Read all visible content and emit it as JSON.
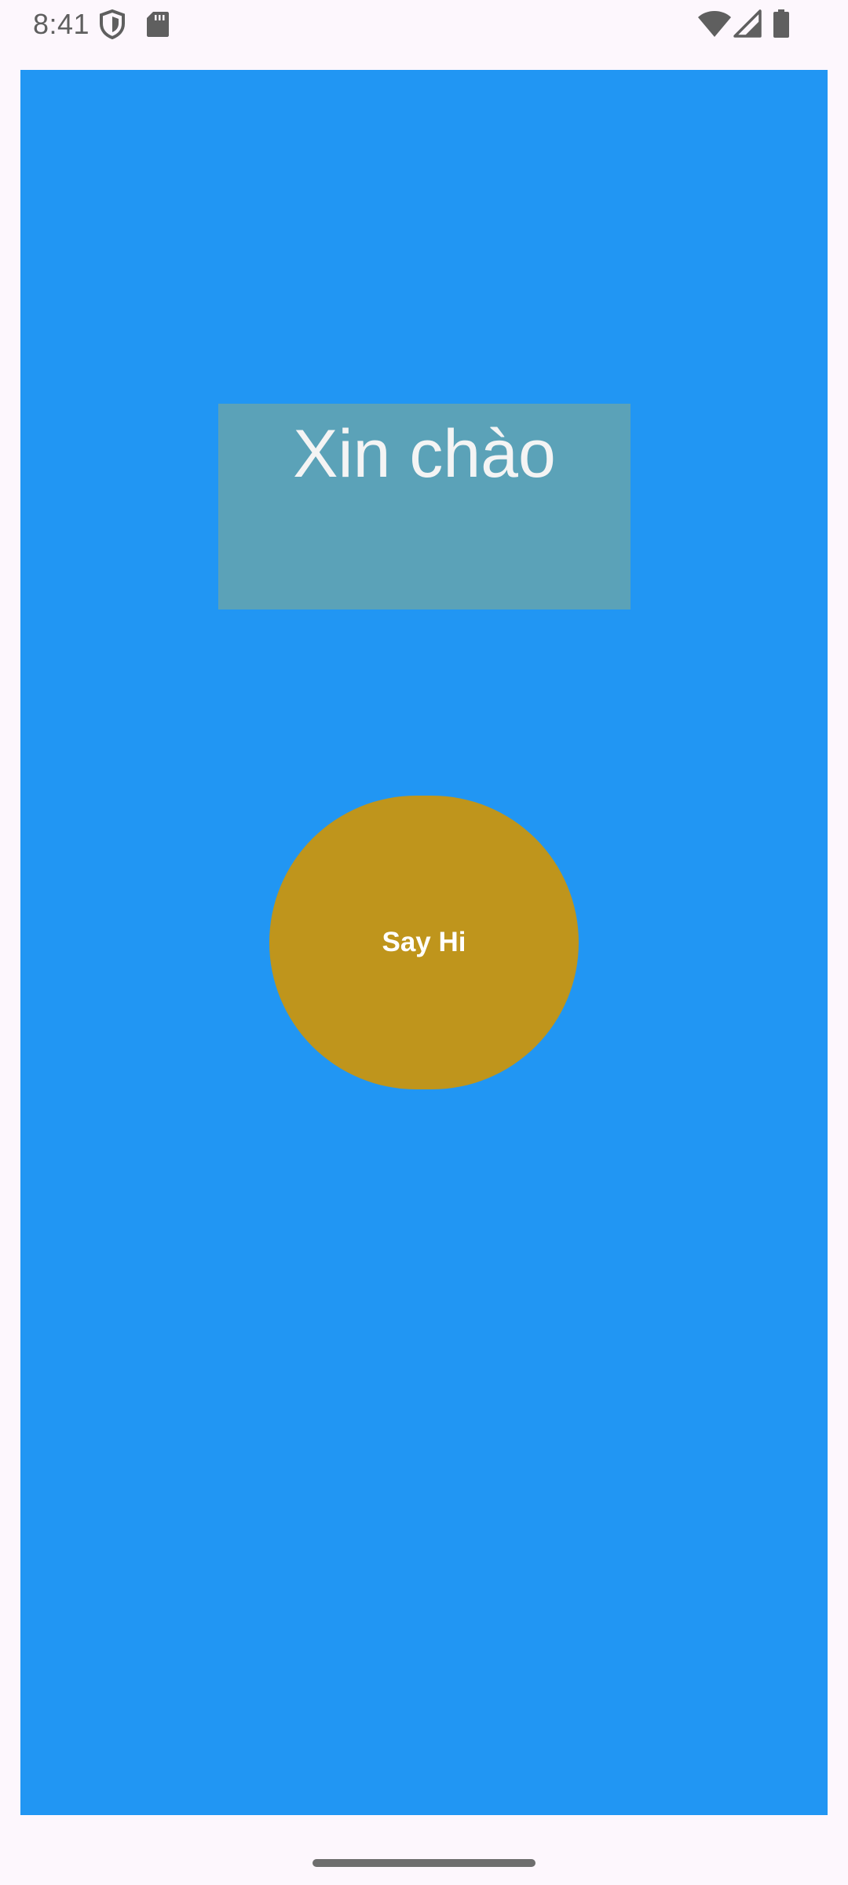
{
  "status_bar": {
    "time": "8:41",
    "icons": [
      "shield-icon",
      "sd-card-icon",
      "wifi-icon",
      "cell-signal-icon",
      "battery-icon"
    ]
  },
  "main": {
    "greeting": "Xin chào",
    "button_label": "Say Hi"
  },
  "colors": {
    "background": "#2196F3",
    "greeting_box": "#5BA2B8",
    "button": "#BF951C",
    "system_bars": "#FDF7FD"
  }
}
